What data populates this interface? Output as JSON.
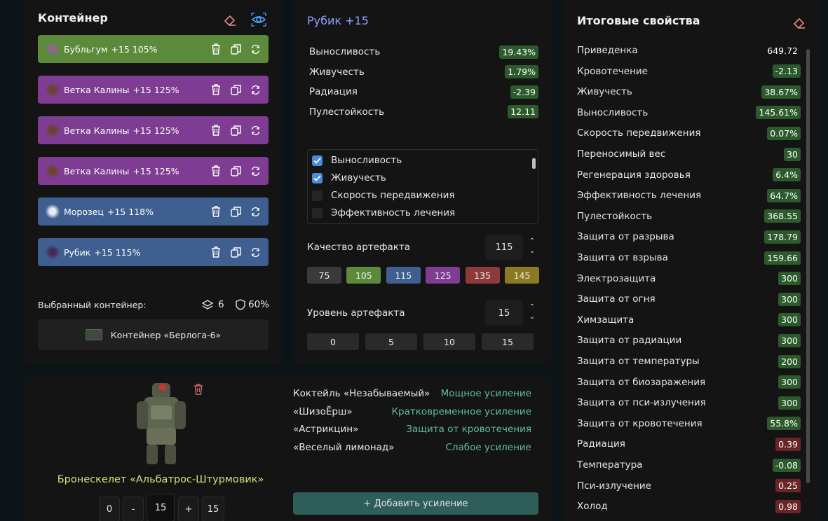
{
  "container": {
    "title": "Контейнер",
    "artifacts": [
      {
        "name": "Бубльгум",
        "level": "+15",
        "quality": "105%",
        "color": "#5b8a3a",
        "thumb": "#8c6a8c"
      },
      {
        "name": "Ветка Калины",
        "level": "+15",
        "quality": "125%",
        "color": "#7e3d92",
        "thumb": "#6b4330"
      },
      {
        "name": "Ветка Калины",
        "level": "+15",
        "quality": "125%",
        "color": "#7e3d92",
        "thumb": "#6b4330"
      },
      {
        "name": "Ветка Калины",
        "level": "+15",
        "quality": "125%",
        "color": "#7e3d92",
        "thumb": "#6b4330"
      },
      {
        "name": "Морозец",
        "level": "+15",
        "quality": "118%",
        "color": "#3e5f8f",
        "thumb": "#e8ecf5"
      },
      {
        "name": "Рубик",
        "level": "+15",
        "quality": "115%",
        "color": "#3e5f8f",
        "thumb": "#4a2a55"
      }
    ],
    "selected_label": "Выбранный контейнер:",
    "slots": "6",
    "protection": "60%",
    "container_name": "Контейнер «Берлога-6»"
  },
  "artifact": {
    "title": "Рубик +15",
    "stats": [
      {
        "name": "Выносливость",
        "value": "19.43%",
        "tone": "green"
      },
      {
        "name": "Живучесть",
        "value": "1.79%",
        "tone": "green"
      },
      {
        "name": "Радиация",
        "value": "-2.39",
        "tone": "green"
      },
      {
        "name": "Пулестойкость",
        "value": "12.11",
        "tone": "green"
      }
    ],
    "checklist": [
      {
        "label": "Выносливость",
        "checked": true
      },
      {
        "label": "Живучесть",
        "checked": true
      },
      {
        "label": "Скорость передвижения",
        "checked": false
      },
      {
        "label": "Эффективность лечения",
        "checked": false
      }
    ],
    "quality_label": "Качество артефакта",
    "quality_value": "115",
    "quality_presets": [
      {
        "label": "75",
        "color": "#3a3a3a"
      },
      {
        "label": "105",
        "color": "#5b8a3a"
      },
      {
        "label": "115",
        "color": "#3e5f8f"
      },
      {
        "label": "125",
        "color": "#7e3d92"
      },
      {
        "label": "135",
        "color": "#8e3a3a"
      },
      {
        "label": "145",
        "color": "#8a7a22"
      }
    ],
    "level_label": "Уровень артефакта",
    "level_value": "15",
    "level_presets": [
      "0",
      "5",
      "10",
      "15"
    ]
  },
  "totals": {
    "title": "Итоговые свойства",
    "rows": [
      {
        "name": "Приведенка",
        "value": "649.72",
        "tone": "plain"
      },
      {
        "name": "Кровотечение",
        "value": "-2.13",
        "tone": "green"
      },
      {
        "name": "Живучесть",
        "value": "38.67%",
        "tone": "green"
      },
      {
        "name": "Выносливость",
        "value": "145.61%",
        "tone": "green"
      },
      {
        "name": "Скорость передвижения",
        "value": "0.07%",
        "tone": "green"
      },
      {
        "name": "Переносимый вес",
        "value": "30",
        "tone": "green"
      },
      {
        "name": "Регенерация здоровья",
        "value": "6.4%",
        "tone": "green"
      },
      {
        "name": "Эффективность лечения",
        "value": "64.7%",
        "tone": "green"
      },
      {
        "name": "Пулестойкость",
        "value": "368.55",
        "tone": "green"
      },
      {
        "name": "Защита от разрыва",
        "value": "178.79",
        "tone": "green"
      },
      {
        "name": "Защита от взрыва",
        "value": "159.66",
        "tone": "green"
      },
      {
        "name": "Электрозащита",
        "value": "300",
        "tone": "green"
      },
      {
        "name": "Защита от огня",
        "value": "300",
        "tone": "green"
      },
      {
        "name": "Химзащита",
        "value": "300",
        "tone": "green"
      },
      {
        "name": "Защита от радиации",
        "value": "300",
        "tone": "green"
      },
      {
        "name": "Защита от температуры",
        "value": "200",
        "tone": "green"
      },
      {
        "name": "Защита от биозаражения",
        "value": "300",
        "tone": "green"
      },
      {
        "name": "Защита от пси-излучения",
        "value": "300",
        "tone": "green"
      },
      {
        "name": "Защита от кровотечения",
        "value": "55.8%",
        "tone": "green"
      },
      {
        "name": "Радиация",
        "value": "0.39",
        "tone": "red"
      },
      {
        "name": "Температура",
        "value": "-0.08",
        "tone": "green"
      },
      {
        "name": "Пси-излучение",
        "value": "0.25",
        "tone": "red"
      },
      {
        "name": "Холод",
        "value": "0.98",
        "tone": "red"
      }
    ]
  },
  "armor": {
    "name": "Бронескелет «Альбатрос-Штурмовик»",
    "boosts": [
      {
        "name": "Коктейль «Незабываемый»",
        "effect": "Мощное усиление"
      },
      {
        "name": "«ШизоЁрш»",
        "effect": "Кратковременное усиление"
      },
      {
        "name": "«Астрикцин»",
        "effect": "Защита от кровотечения"
      },
      {
        "name": "«Веселый лимонад»",
        "effect": "Слабое усиление"
      }
    ],
    "add_boost_label": "+ Добавить усиление",
    "level_min": "0",
    "minus": "-",
    "level_value": "15",
    "plus": "+",
    "level_max": "15"
  }
}
